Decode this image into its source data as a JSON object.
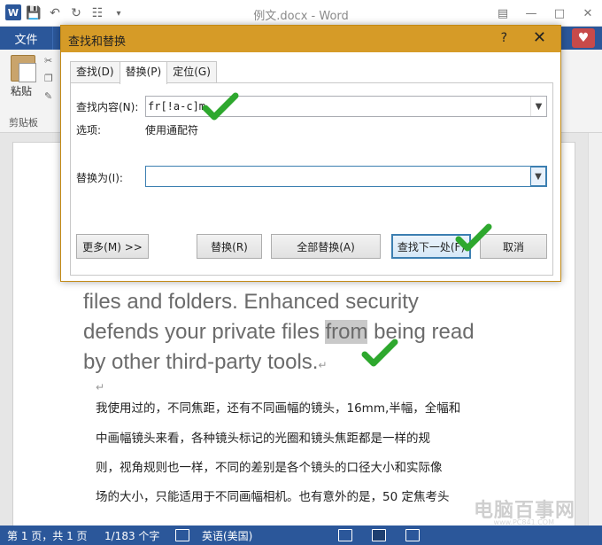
{
  "window": {
    "title": "例文.docx - Word",
    "app_icon": "W"
  },
  "ribbon": {
    "file_tab": "文件",
    "paste_label": "粘贴",
    "clipboard_group": "剪贴板"
  },
  "dialog": {
    "title": "查找和替换",
    "help": "?",
    "tabs": [
      "查找(D)",
      "替换(P)",
      "定位(G)"
    ],
    "find_label": "查找内容(N):",
    "find_value": "fr[!a-c]m",
    "options_label": "选项:",
    "options_value": "使用通配符",
    "replace_label": "替换为(I):",
    "replace_value": "",
    "buttons": {
      "more": "更多(M) >>",
      "replace": "替换(R)",
      "replace_all": "全部替换(A)",
      "find_next": "查找下一处(F)",
      "cancel": "取消"
    }
  },
  "document": {
    "english_lines": [
      "files and folders. Enhanced security",
      "defends your private files ",
      "from",
      " being read",
      "by other third-party tools."
    ],
    "chinese_lines": [
      "我使用过的，不同焦距，还有不同画幅的镜头，16mm,半幅，全幅和",
      "中画幅镜头来看，各种镜头标记的光圈和镜头焦距都是一样的规",
      "则，视角规则也一样，不同的差别是各个镜头的口径大小和实际像",
      "场的大小，只能适用于不同画幅相机。也有意外的是，50 定焦考头"
    ]
  },
  "statusbar": {
    "page": "第 1 页，共 1 页",
    "words": "1/183 个字",
    "language": "英语(美国)"
  },
  "watermark": {
    "main": "电脑百事网",
    "sub": "www.PC841.COM"
  },
  "colors": {
    "word_blue": "#2b579a",
    "dialog_title": "#d69b27",
    "check_green": "#2ea82e"
  }
}
